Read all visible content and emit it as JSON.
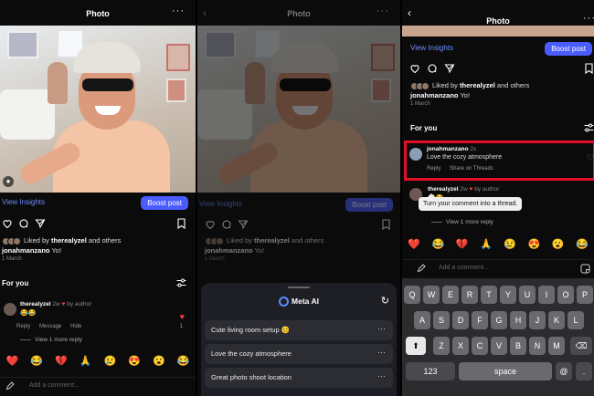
{
  "panel1": {
    "title": "Photo",
    "more": "···",
    "view_insights": "View Insights",
    "boost": "Boost post",
    "liked_prefix": "Liked by",
    "liked_user": "therealyzel",
    "liked_suffix": "and others",
    "caption_user": "jonahmanzano",
    "caption_text": "Yo!",
    "date": "1 March",
    "for_you": "For you",
    "comment": {
      "user": "therealyzel",
      "time": "2w",
      "by_author": "by author",
      "text": "😂😂",
      "reply": "Reply",
      "message": "Message",
      "hide": "Hide",
      "like_count": "1"
    },
    "view_more": "View 1 more reply",
    "emojis": [
      "❤️",
      "😂",
      "💔",
      "🙏",
      "😢",
      "😍",
      "😮",
      "😂"
    ],
    "comment_placeholder": "Add a comment..."
  },
  "panel2": {
    "title": "Photo",
    "more": "···",
    "view_insights": "View Insights",
    "boost": "Boost post",
    "liked_prefix": "Liked by",
    "liked_user": "therealyzel",
    "liked_suffix": "and others",
    "caption_user": "jonahmanzano",
    "caption_text": "Yo!",
    "date": "1 March",
    "sheet_title": "Meta AI",
    "suggestions": [
      "Cute living room setup 😊",
      "Love the cozy atmosphere",
      "Great photo shoot location"
    ]
  },
  "panel3": {
    "title": "Photo",
    "more": "···",
    "view_insights": "View Insights",
    "boost": "Boost post",
    "liked_prefix": "Liked by",
    "liked_user": "therealyzel",
    "liked_suffix": "and others",
    "caption_user": "jonahmanzano",
    "caption_text": "Yo!",
    "date": "1 March",
    "for_you": "For you",
    "new_comment": {
      "user": "jonahmanzano",
      "time": "2s",
      "text": "Love the cozy atmosphere",
      "reply": "Reply",
      "share": "Share on Threads"
    },
    "old_comment": {
      "user": "therealyzel",
      "time": "2w",
      "by_author": "by author",
      "text": "😂😂"
    },
    "tooltip": "Turn your comment into a thread.",
    "view_more": "View 1 more reply",
    "emojis": [
      "❤️",
      "😂",
      "💔",
      "🙏",
      "😢",
      "😍",
      "😮",
      "😂"
    ],
    "comment_placeholder": "Add a comment...",
    "keyboard": {
      "row1": [
        "Q",
        "W",
        "E",
        "R",
        "T",
        "Y",
        "U",
        "I",
        "O",
        "P"
      ],
      "row2": [
        "A",
        "S",
        "D",
        "F",
        "G",
        "H",
        "J",
        "K",
        "L"
      ],
      "row3": [
        "Z",
        "X",
        "C",
        "V",
        "B",
        "N",
        "M"
      ],
      "numbers": "123",
      "space": "space",
      "at": "@",
      "dot": "."
    }
  },
  "colors": {
    "accent": "#4a5cff",
    "link": "#6f8cff",
    "highlight": "#e3102a",
    "heart": "#ff3b3b"
  }
}
